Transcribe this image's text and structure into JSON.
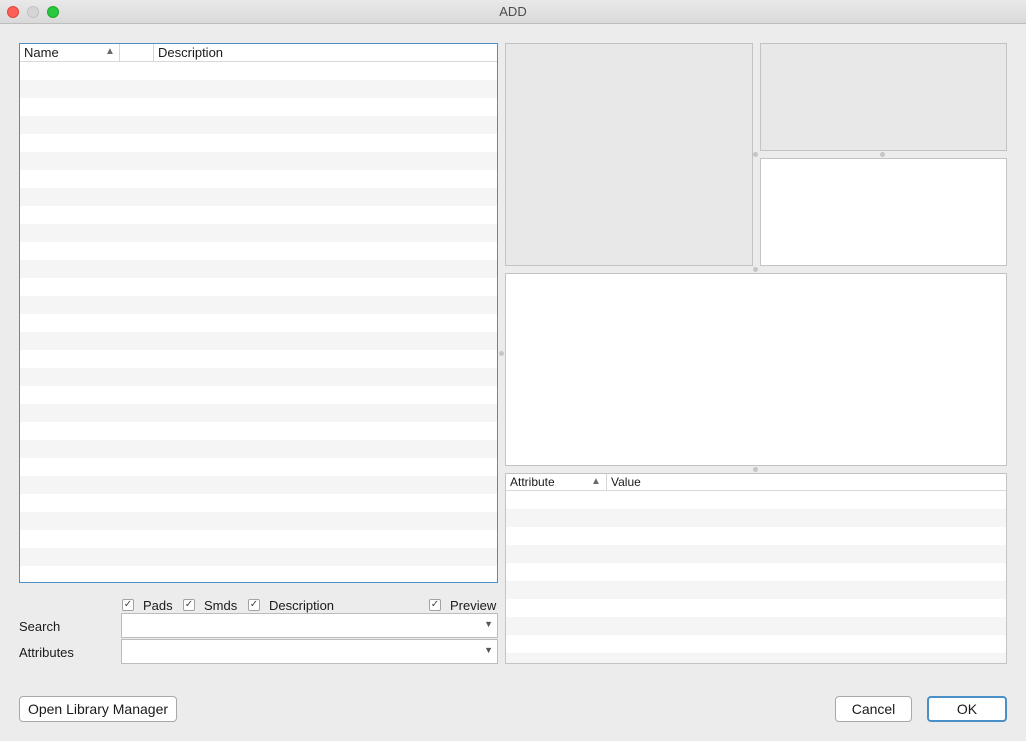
{
  "window": {
    "title": "ADD"
  },
  "library_table": {
    "columns": [
      {
        "label": "Name",
        "sorted": "ascending",
        "sort_glyph": "▲"
      },
      {
        "label": ""
      },
      {
        "label": "Description"
      }
    ]
  },
  "attributes_table": {
    "columns": [
      {
        "label": "Attribute",
        "sorted": "ascending",
        "sort_glyph": "▲"
      },
      {
        "label": "Value"
      }
    ]
  },
  "filters": {
    "pads": {
      "label": "Pads",
      "checked": true
    },
    "smds": {
      "label": "Smds",
      "checked": true
    },
    "description": {
      "label": "Description",
      "checked": true
    },
    "preview": {
      "label": "Preview",
      "checked": true
    },
    "check_glyph": "✓"
  },
  "search": {
    "label": "Search",
    "value": "",
    "arrow": "▼"
  },
  "attributes": {
    "label": "Attributes",
    "value": "",
    "arrow": "▼"
  },
  "buttons": {
    "open_library_manager": "Open Library Manager",
    "cancel": "Cancel",
    "ok": "OK"
  },
  "colors": {
    "accent": "#4a90c8",
    "window_bg": "#ececec",
    "preview_bg": "#e8e8e8"
  }
}
